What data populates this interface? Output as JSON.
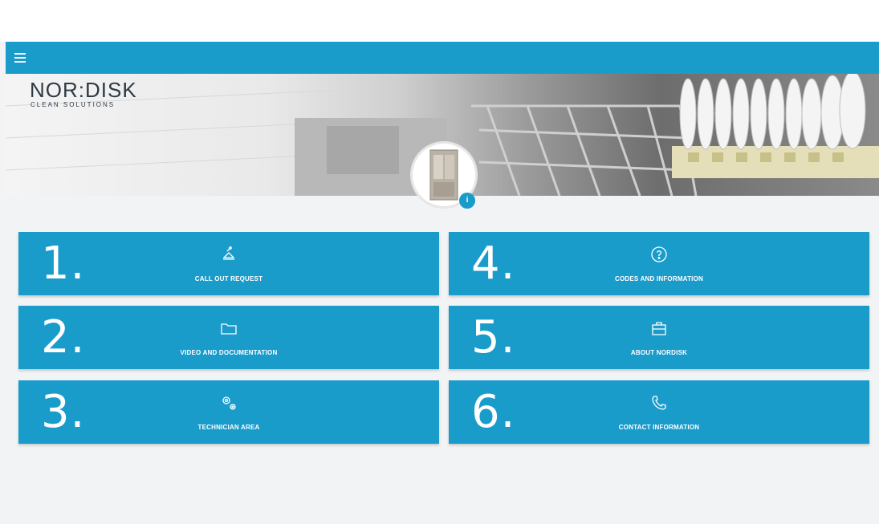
{
  "header": {
    "menu_icon": "hamburger-menu-icon",
    "accent": "#1a9ccb"
  },
  "hero": {
    "logo_main": "NOR:DISK",
    "logo_sub": "CLEAN SOLUTIONS",
    "info_label": "i"
  },
  "tiles": [
    {
      "number": "1.",
      "label": "CALL OUT REQUEST",
      "icon": "service-bell-icon"
    },
    {
      "number": "2.",
      "label": "VIDEO AND DOCUMENTATION",
      "icon": "folder-icon"
    },
    {
      "number": "3.",
      "label": "TECHNICIAN AREA",
      "icon": "gears-icon"
    },
    {
      "number": "4.",
      "label": "CODES AND INFORMATION",
      "icon": "question-circle-icon"
    },
    {
      "number": "5.",
      "label": "ABOUT NORDISK",
      "icon": "briefcase-icon"
    },
    {
      "number": "6.",
      "label": "CONTACT INFORMATION",
      "icon": "phone-icon"
    }
  ]
}
